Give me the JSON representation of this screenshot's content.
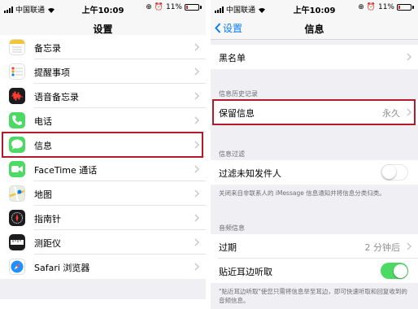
{
  "status_bar": {
    "carrier": "中国联通",
    "time": "上午10:09",
    "battery": "11%"
  },
  "left_screen": {
    "title": "设置",
    "items": [
      {
        "label": "备忘录",
        "icon": "notes-icon"
      },
      {
        "label": "提醒事项",
        "icon": "reminders-icon"
      },
      {
        "label": "语音备忘录",
        "icon": "voice-memos-icon"
      },
      {
        "label": "电话",
        "icon": "phone-icon"
      },
      {
        "label": "信息",
        "icon": "messages-icon",
        "highlighted": true
      },
      {
        "label": "FaceTime 通话",
        "icon": "facetime-icon"
      },
      {
        "label": "地图",
        "icon": "maps-icon"
      },
      {
        "label": "指南针",
        "icon": "compass-icon"
      },
      {
        "label": "测距仪",
        "icon": "measure-icon"
      },
      {
        "label": "Safari 浏览器",
        "icon": "safari-icon"
      }
    ]
  },
  "right_screen": {
    "back_label": "设置",
    "title": "信息",
    "blocked": "黑名单",
    "history_section": "信息历史记录",
    "keep_messages": "保留信息",
    "keep_messages_value": "永久",
    "filtering_section": "信息过滤",
    "filter_unknown": "过滤未知发件人",
    "filter_unknown_on": false,
    "filter_note": "关闭来自非联系人的 iMessage 信息通知并将信息分类归类。",
    "audio_section": "音频信息",
    "expire": "过期",
    "expire_value": "2 分钟后",
    "raise_to_listen": "贴近耳边听取",
    "raise_to_listen_on": true,
    "raise_note": "\"贴近耳边听取\"使您只需将信息举至耳边，即可快速听取和回复收到的音频信息。"
  },
  "colors": {
    "accent": "#0a7aff",
    "highlight": "#b4192c",
    "toggle_on": "#4cd964"
  }
}
